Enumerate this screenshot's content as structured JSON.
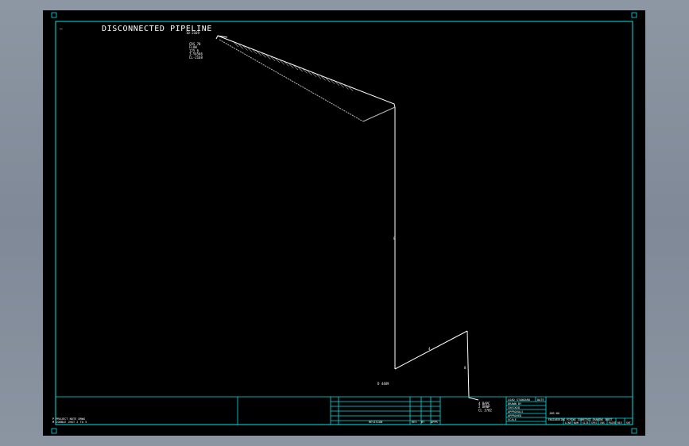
{
  "window": {
    "title": "DISCONNECTED PIPELINE"
  },
  "colors": {
    "background": "#000000",
    "frame": "#00e5e5",
    "pipe": "#ffffff",
    "desk": "#8a94a1"
  },
  "drawing": {
    "title": "DISCONNECTED PIPELINE",
    "axis_label": "—",
    "labels": {
      "start_block": [
        "CRS 70",
        "FLOW",
        "125 6",
        "3-Y4546",
        "CL-2168"
      ],
      "start_tag": "10-2169",
      "mid_tag": "8",
      "low_tag": "D 4489",
      "diag_tag": "4",
      "short_tag": "8",
      "end_block": [
        "4 BAPC",
        "2 DRNP",
        "CL 1702"
      ]
    }
  },
  "title_block": {
    "bottom_left": [
      "P PROJECT NOTE DRWG",
      "M JOBBLE JHGT 2 TO 5"
    ],
    "revision_header": "REVISION",
    "rev_cols": [
      "REV",
      "BY",
      "APPR"
    ],
    "approval_rows": [
      "LOAD STANDARD",
      "DRAWN BY",
      "CHECKED",
      "APPROVALS",
      "APPROVED",
      "SCALE"
    ],
    "date_label": "DATE",
    "job_label": "JOB NO",
    "company_line": "ENGINEERING PIPING ISOMETRIC DRAWING SHEET",
    "bottom_cells": [
      "LINE",
      "NUM",
      "SIZE",
      "SPEC",
      "INS",
      "PAINT",
      "REV",
      "SHT"
    ]
  }
}
